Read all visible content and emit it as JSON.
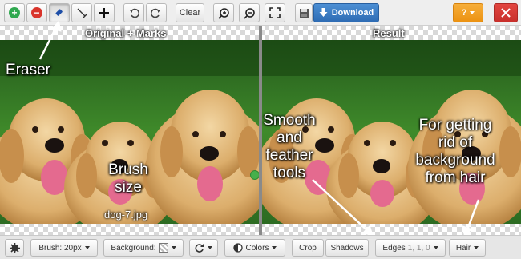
{
  "toolbar": {
    "clear_label": "Clear",
    "download_label": "Download",
    "help_label": "?",
    "colors": {
      "green": "#2fa84f",
      "red": "#d9342b",
      "blue": "#2e6cb4",
      "orange": "#ee9a1e"
    }
  },
  "icons": {
    "add_mark": "plus-circle-icon",
    "remove_mark": "minus-circle-icon",
    "brush": "brush-icon",
    "eraser": "eraser-icon",
    "move": "move-icon",
    "undo": "undo-icon",
    "redo": "redo-icon",
    "zoom_in": "zoom-in-icon",
    "zoom_out": "zoom-out-icon",
    "fit": "fit-screen-icon",
    "save": "save-icon",
    "download": "download-icon",
    "close": "close-icon",
    "settings": "gear-icon",
    "rotate": "rotate-icon",
    "contrast": "contrast-icon"
  },
  "panes": {
    "left_label": "Original + Marks",
    "right_label": "Result",
    "file_name": "dog-7.jpg"
  },
  "annotations": {
    "eraser": "Eraser",
    "brush_size": "Brush\nsize",
    "smooth": "Smooth\nand\nfeather\ntools",
    "hair": "For getting\nrid of\nbackground\nfrom hair"
  },
  "bottom": {
    "brush_label": "Brush: 20px",
    "background_label": "Background:",
    "colors_label": "Colors",
    "crop_label": "Crop",
    "shadows_label": "Shadows",
    "edges_label": "Edges",
    "edges_values": "1, 1, 0",
    "hair_label": "Hair"
  }
}
